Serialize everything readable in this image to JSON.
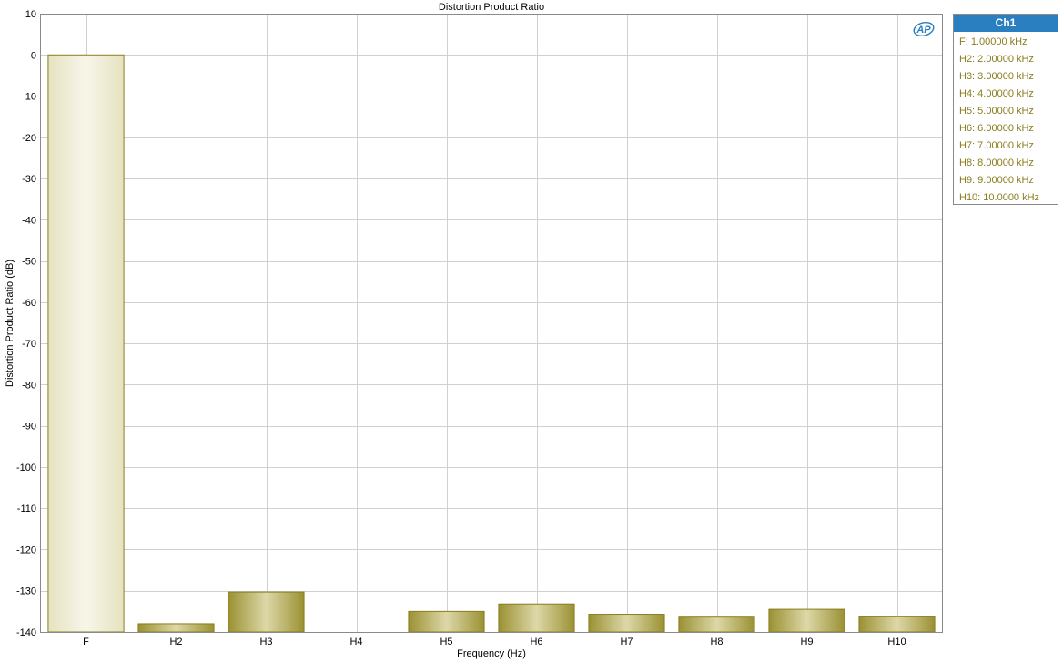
{
  "chart_data": {
    "type": "bar",
    "title": "Distortion Product Ratio",
    "xlabel": "Frequency (Hz)",
    "ylabel": "Distortion Product Ratio (dB)",
    "ylim": [
      -140,
      10
    ],
    "yticks": [
      10,
      0,
      -10,
      -20,
      -30,
      -40,
      -50,
      -60,
      -70,
      -80,
      -90,
      -100,
      -110,
      -120,
      -130,
      -140
    ],
    "categories": [
      "F",
      "H2",
      "H3",
      "H4",
      "H5",
      "H6",
      "H7",
      "H8",
      "H9",
      "H10"
    ],
    "series": [
      {
        "name": "Ch1",
        "values": [
          0,
          -138,
          -130.3,
          null,
          -135,
          -133.2,
          -135.7,
          -136.4,
          -134.5,
          -136.3
        ]
      }
    ],
    "grid": true,
    "legend_placement": "right",
    "colors": {
      "bar_fundamental_light": "#f6f4e6",
      "bar_fundamental_dark": "#e6e2c0",
      "bar_harmonic_light": "#dcd7a6",
      "bar_harmonic_dark": "#9a9133",
      "bar_stroke": "#8a7d1c",
      "grid": "#d0d0d0",
      "legend_header": "#2a7fc0",
      "legend_text": "#8a7d1c"
    }
  },
  "legend": {
    "header": "Ch1",
    "items": [
      "F: 1.00000 kHz",
      "H2: 2.00000 kHz",
      "H3: 3.00000 kHz",
      "H4: 4.00000 kHz",
      "H5: 5.00000 kHz",
      "H6: 6.00000 kHz",
      "H7: 7.00000 kHz",
      "H8: 8.00000 kHz",
      "H9: 9.00000 kHz",
      "H10: 10.0000 kHz"
    ]
  },
  "logo": {
    "icon": "ap-logo-icon",
    "text": "AP"
  }
}
